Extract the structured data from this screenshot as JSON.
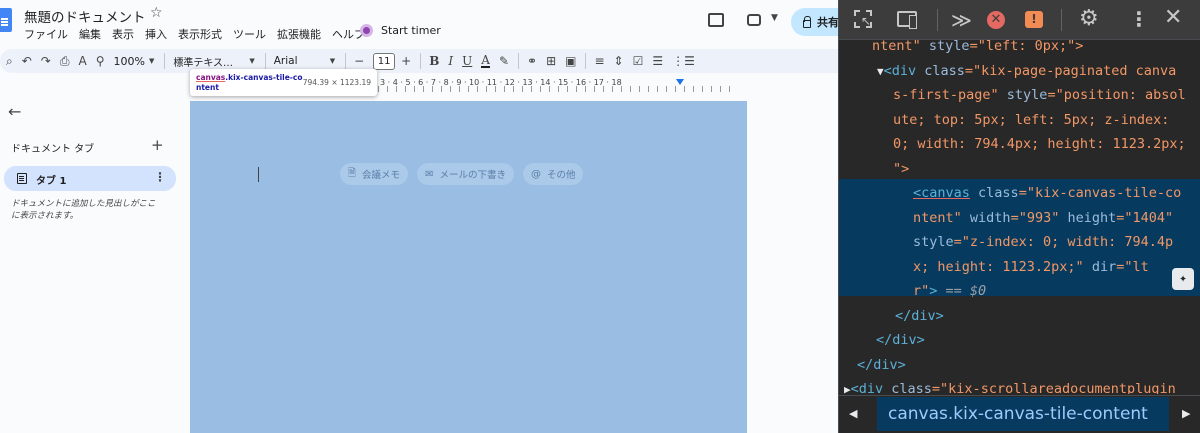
{
  "docs": {
    "title": "無題のドキュメント",
    "star": "☆",
    "menu": [
      "ファイル",
      "編集",
      "表示",
      "挿入",
      "表示形式",
      "ツール",
      "拡張機能",
      "ヘルプ"
    ],
    "timer_label": "Start timer",
    "share_label": "共有",
    "toolbar": {
      "search": "⌕",
      "undo": "↶",
      "redo": "↷",
      "print": "⎙",
      "spell": "A",
      "paint": "⚲",
      "zoom": "100%",
      "style": "標準テキス…",
      "font": "Arial",
      "minus": "−",
      "size": "11",
      "plus": "+",
      "bold": "B",
      "italic": "I",
      "underline": "U",
      "text_color": "A",
      "highlight": "✎",
      "link": "⚭",
      "comment": "⊞",
      "image": "▣",
      "align": "≡",
      "spacing": "⇕",
      "checklist": "☑",
      "bullets": "☰",
      "numbered": "⋮☰"
    },
    "ruler_numbers": "3 · 4 · 5 · 6 · 7 · 8 · 9 · 10 · 11 · 12 · 13 · 14 · 15 · 16 · 17 · 18",
    "tooltip": {
      "tag": "canvas",
      "class_line1": ".kix-canvas-tile-co",
      "class_line2": "ntent",
      "dims": "794.39 × 1123.19"
    },
    "sidebar": {
      "back": "←",
      "heading": "ドキュメント タブ",
      "add": "+",
      "tab_label": "タブ 1",
      "tab_more": "⋮",
      "hint": "ドキュメントに追加した見出しがここに表示されます。"
    },
    "chips": [
      {
        "icon": "🗎",
        "label": "会議メモ"
      },
      {
        "icon": "✉",
        "label": "メールの下書き"
      },
      {
        "icon": "@",
        "label": "その他"
      }
    ]
  },
  "devtools": {
    "toolbar": {
      "more_tabs": "≫",
      "error": "✕",
      "warning": "!",
      "settings": "⚙",
      "more": "⋮",
      "close": "✕"
    },
    "code": {
      "l0_a": "ntent\"",
      "l0_b": " style",
      "l0_c": "=\"left: 0px;\">",
      "l1_tag": "<div",
      "l1_attr": " class",
      "l1_val": "=\"kix-page-paginated canva",
      "l2": "s-first-page\"",
      "l2_attr": " style",
      "l2_val": "=\"position: absol",
      "l3": "ute; top: 5px; left: 5px; z-index:",
      "l4": "0; width: 794.4px; height: 1123.2px;",
      "l5": "\">",
      "l6_tag": "<canvas",
      "l6_attr": " class",
      "l6_val": "=\"kix-canvas-tile-co",
      "l7_val": "ntent\"",
      "l7_attr": " width",
      "l7_v2": "=\"993\"",
      "l7_attr2": " height",
      "l7_v3": "=\"1404\"",
      "l8_attr": "style",
      "l8_val": "=\"z-index: 0; width: 794.4p",
      "l9": "x; height: 1123.2px;\"",
      "l9_attr": " dir",
      "l9_val": "=\"lt",
      "l10_val": "r\"",
      "l10_tag": ">",
      "l10_eq": " == $0",
      "l11": "</div>",
      "l12": "</div>",
      "l13": "</div>",
      "l14_tag": "<div",
      "l14_attr": " class",
      "l14_val": "=\"kix-scrollareadocumentplugin"
    },
    "breadcrumb": {
      "left": "◀",
      "right": "▶",
      "tag": "canvas",
      "cls": ".kix-canvas-tile-content"
    }
  }
}
